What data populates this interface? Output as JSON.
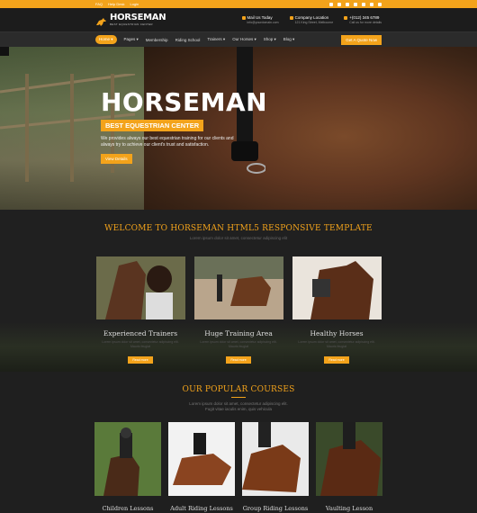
{
  "topbar": {
    "links": [
      "FAQ",
      "Help Desk",
      "Login"
    ],
    "social_icons": [
      "facebook-icon",
      "twitter-icon",
      "google-plus-icon",
      "linkedin-icon",
      "instagram-icon",
      "pinterest-icon",
      "rss-icon"
    ]
  },
  "header": {
    "logo_name": "HORSEMAN",
    "logo_sub": "BEST EQUESTRIAN CENTER",
    "contacts": [
      {
        "icon": "mail-icon",
        "label": "Mail Us Today",
        "value": "info@yourdomain.com"
      },
      {
        "icon": "location-icon",
        "label": "Company Location",
        "value": "121 King Street, Melbourne"
      },
      {
        "icon": "phone-icon",
        "label": "+(012) 345 6789",
        "value": "Call us for more details"
      }
    ]
  },
  "nav": {
    "items": [
      "Home ▾",
      "Pages ▾",
      "Membership",
      "Riding School",
      "Trainers ▾",
      "Our Horses ▾",
      "Shop ▾",
      "Blog ▾"
    ],
    "quote_button": "Get A Quote Now"
  },
  "hero": {
    "title": "HORSEMAN",
    "badge": "BEST EQUESTRIAN CENTER",
    "description": "We provides always our best equestrian training for our clients and always try to achieve our client's trust and satisfaction.",
    "button": "View Details"
  },
  "welcome": {
    "title": "WELCOME TO HORSEMAN HTML5 RESPONSIVE TEMPLATE",
    "subtitle": "Lorem ipsum dolor sit amet, consectetur adipiscing elit",
    "cards": [
      {
        "title": "Experienced Trainers",
        "text": "Lorem ipsum dolor sit amet, consectetur adipiscing elit. Mauris feugiat",
        "button": "Read more"
      },
      {
        "title": "Huge Training Area",
        "text": "Lorem ipsum dolor sit amet, consectetur adipiscing elit. Mauris feugiat",
        "button": "Read more"
      },
      {
        "title": "Healthy Horses",
        "text": "Lorem ipsum dolor sit amet, consectetur adipiscing elit. Mauris feugiat",
        "button": "Read more"
      }
    ]
  },
  "courses": {
    "title": "OUR POPULAR COURSES",
    "subtitle": "Lorem ipsum dolor sit amet, consectetur adipiscing elit. Fugit vitae iaculis enim, quis vehicula",
    "items": [
      "Children Lessons",
      "Adult Riding Lessons",
      "Group Riding Lessons",
      "Vaulting Lesson"
    ]
  },
  "colors": {
    "accent": "#f3a31b",
    "background": "#222222"
  }
}
